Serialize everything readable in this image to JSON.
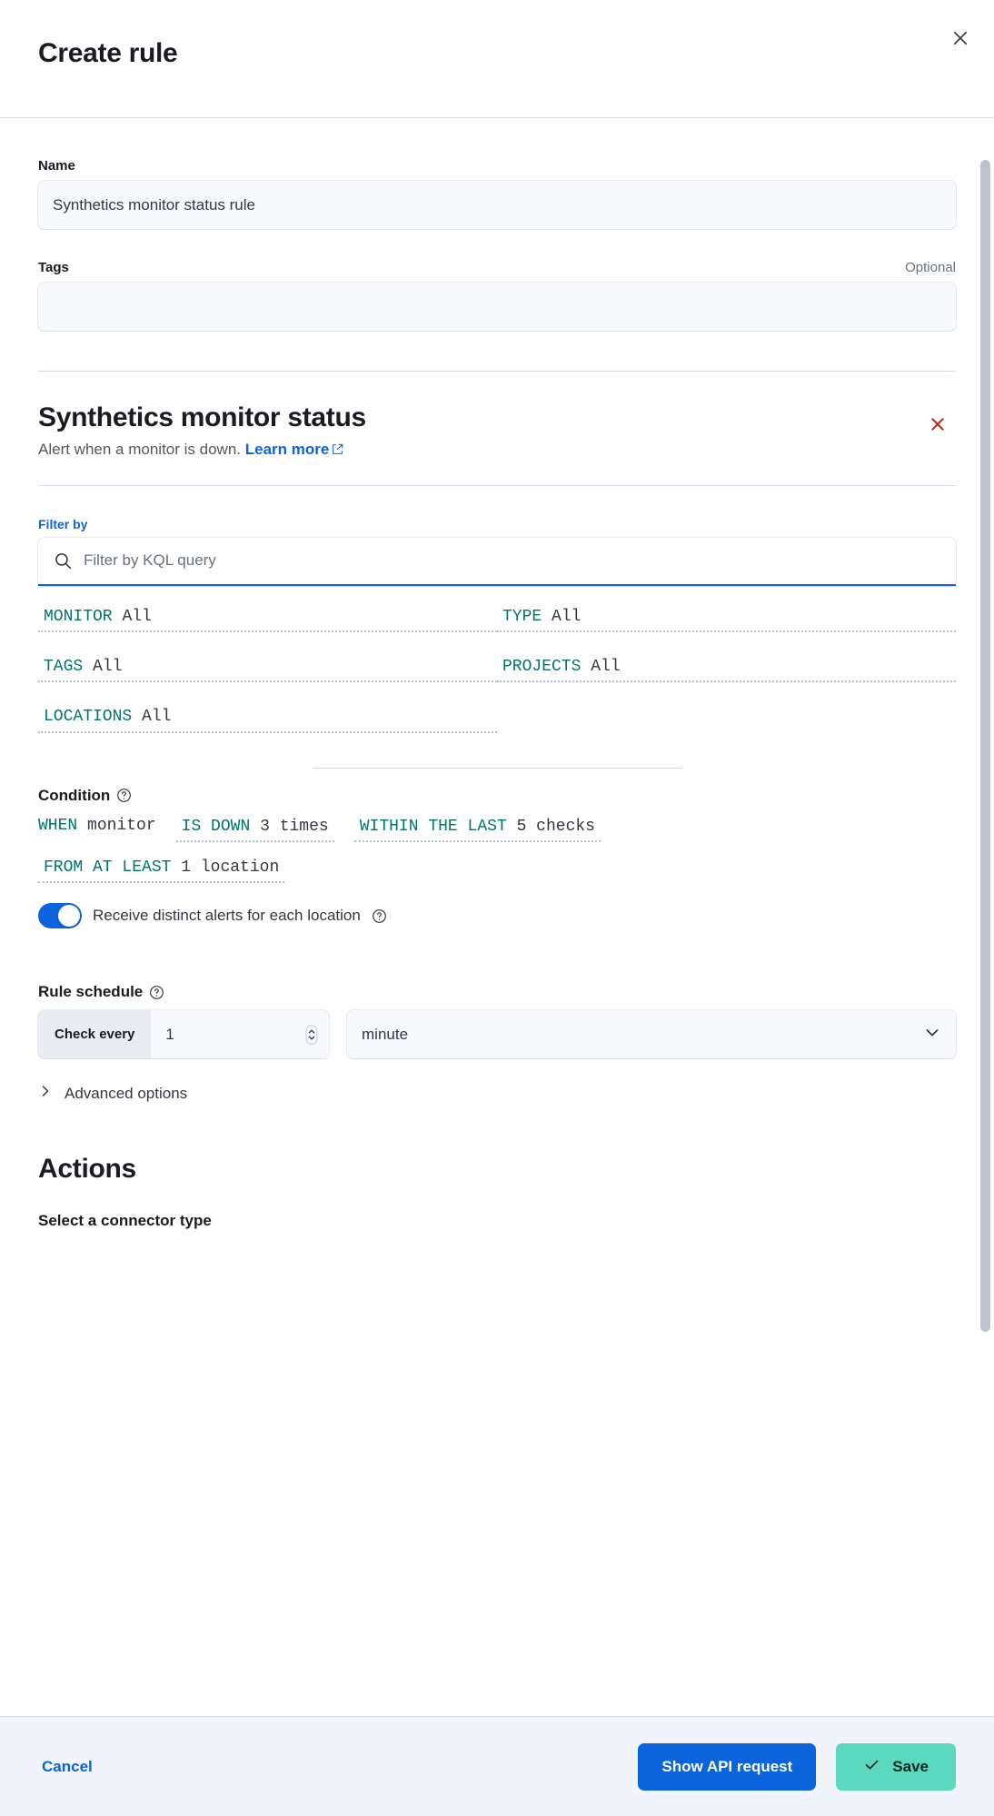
{
  "header": {
    "title": "Create rule",
    "close_icon": "close-icon"
  },
  "form": {
    "name": {
      "label": "Name",
      "value": "Synthetics monitor status rule",
      "placeholder": ""
    },
    "tags": {
      "label": "Tags",
      "optional_text": "Optional",
      "value": "",
      "placeholder": ""
    }
  },
  "rule_type": {
    "title": "Synthetics monitor status",
    "description": "Alert when a monitor is down.",
    "learn_more": "Learn more",
    "external_link_icon": "external-link-icon",
    "delete_icon": "cross-icon"
  },
  "filter": {
    "label": "Filter by",
    "search_icon": "search-icon",
    "query_value": "",
    "query_placeholder": "Filter by KQL query",
    "chips": [
      {
        "keyword": "MONITOR",
        "value": "All"
      },
      {
        "keyword": "TYPE",
        "value": "All"
      },
      {
        "keyword": "TAGS",
        "value": "All"
      },
      {
        "keyword": "PROJECTS",
        "value": "All"
      },
      {
        "keyword": "LOCATIONS",
        "value": "All"
      }
    ]
  },
  "condition": {
    "label": "Condition",
    "help_icon": "question-in-circle-icon",
    "line1": {
      "when_keyword": "WHEN",
      "when_value": "monitor",
      "status_keyword": "IS DOWN",
      "status_value": "3 times",
      "window_keyword": "WITHIN THE LAST",
      "window_value": "5 checks"
    },
    "line2": {
      "locations_keyword": "FROM AT LEAST",
      "locations_value": "1 location"
    },
    "toggle": {
      "label": "Receive distinct alerts for each location",
      "state": "on",
      "help_icon": "question-in-circle-icon"
    }
  },
  "schedule": {
    "label": "Rule schedule",
    "help_icon": "question-in-circle-icon",
    "prepend_label": "Check every",
    "interval_value": "1",
    "unit_value": "minute",
    "stepper_icon": "stepper-arrows-icon",
    "caret_icon": "chevron-down-icon"
  },
  "advanced": {
    "label": "Advanced options",
    "chevron_icon": "chevron-right-icon"
  },
  "actions": {
    "title": "Actions",
    "connector_title": "Select a connector type"
  },
  "footer": {
    "cancel_label": "Cancel",
    "show_api_label": "Show API request",
    "save_label": "Save",
    "save_icon": "check-icon"
  },
  "colors": {
    "accent_blue": "#0b64dd",
    "keyword_teal": "#00756b",
    "save_green": "#5ad9bf",
    "danger_red": "#bd271e"
  }
}
